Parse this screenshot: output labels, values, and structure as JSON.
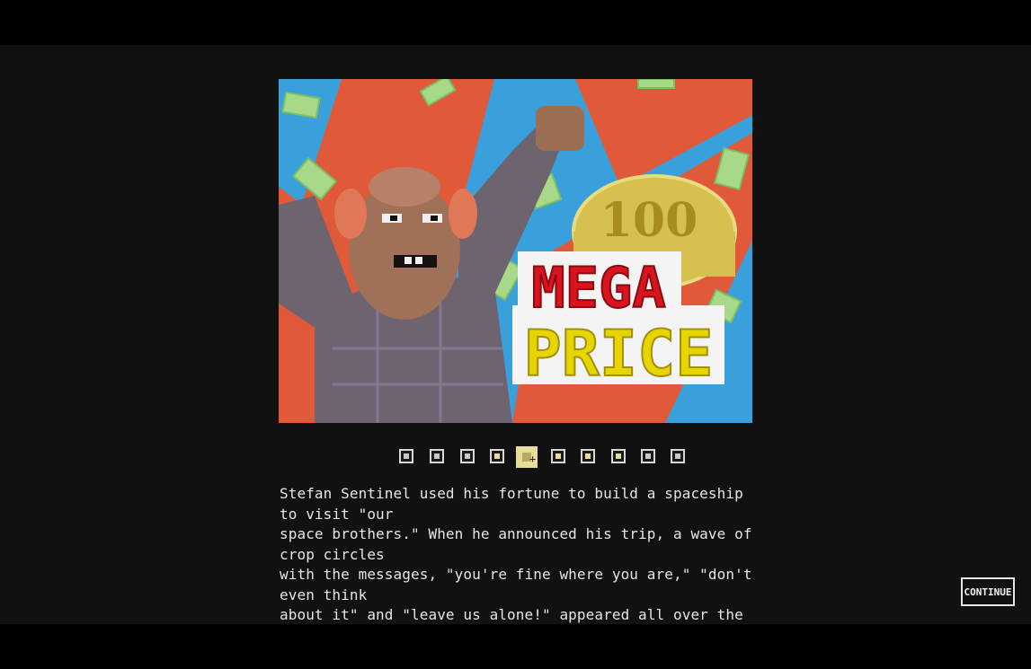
{
  "story": {
    "caption": "Stefan Sentinel used his fortune to build a spaceship to visit \"our\nspace brothers.\" When he announced his trip, a wave of crop circles\nwith the messages, \"you're fine where you are,\" \"don't even think\nabout it\" and \"leave us alone!\" appeared all over the country.",
    "illustration": {
      "coin_text": "100",
      "sign_line_1": "MEGA",
      "sign_line_2": "PRICE"
    }
  },
  "pager": {
    "total": 10,
    "current": 5,
    "pages": [
      {
        "state": "plain"
      },
      {
        "state": "plain"
      },
      {
        "state": "plain"
      },
      {
        "state": "seen"
      },
      {
        "state": "active"
      },
      {
        "state": "seen"
      },
      {
        "state": "seen"
      },
      {
        "state": "seen"
      },
      {
        "state": "plain"
      },
      {
        "state": "plain"
      }
    ]
  },
  "controls": {
    "continue_label": "CONTINUE"
  },
  "colors": {
    "background": "#111111",
    "accent_red": "#e05a3a",
    "accent_blue": "#3aa0dc",
    "sign_red": "#d8141e",
    "sign_yellow": "#e8d400",
    "coin_gold": "#d8c050"
  }
}
